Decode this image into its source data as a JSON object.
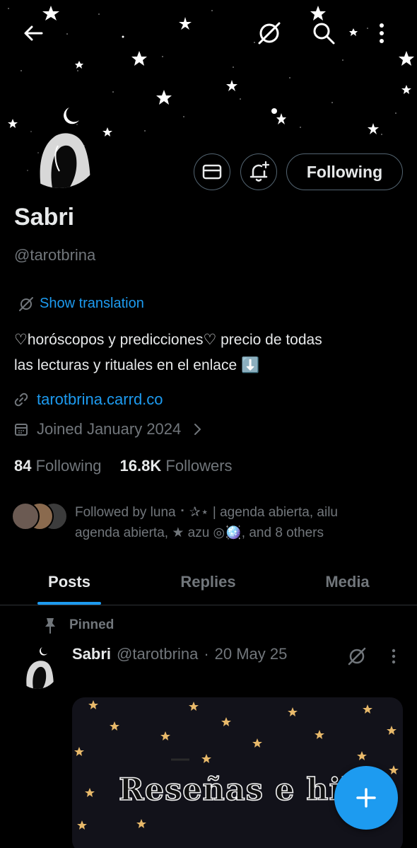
{
  "profile": {
    "name": "Sabri",
    "handle": "@tarotbrina",
    "translate_label": "Show translation",
    "bio_line1": "♡horóscopos y predicciones♡ precio de todas",
    "bio_line2": "las lecturas y rituales en el enlace ⬇️",
    "link": "tarotbrina.carrd.co",
    "joined": "Joined January 2024",
    "following_count": "84",
    "following_label": "Following",
    "followers_count": "16.8K",
    "followers_label": "Followers",
    "followed_by_line1": "Followed by luna ⠂✰⋆ | agenda abierta, ailu",
    "followed_by_line2": "agenda abierta, ★ azu ◎🪩, and 8 others"
  },
  "actions": {
    "follow_label": "Following",
    "icons": [
      "back-arrow-icon",
      "grok-icon",
      "search-icon",
      "more-vertical-icon",
      "mail-icon",
      "bell-plus-icon"
    ]
  },
  "tabs": [
    {
      "label": "Posts",
      "active": true
    },
    {
      "label": "Replies",
      "active": false
    },
    {
      "label": "Media",
      "active": false
    }
  ],
  "pinned_post": {
    "pinned_label": "Pinned",
    "author": "Sabri",
    "handle": "@tarotbrina",
    "separator": "·",
    "date": "20 May 25",
    "media_text": "Reseñas e hilo"
  },
  "colors": {
    "accent": "#1d9bf0",
    "muted": "#71767b",
    "text": "#e7e9ea",
    "border": "#536471",
    "background": "#000000"
  }
}
